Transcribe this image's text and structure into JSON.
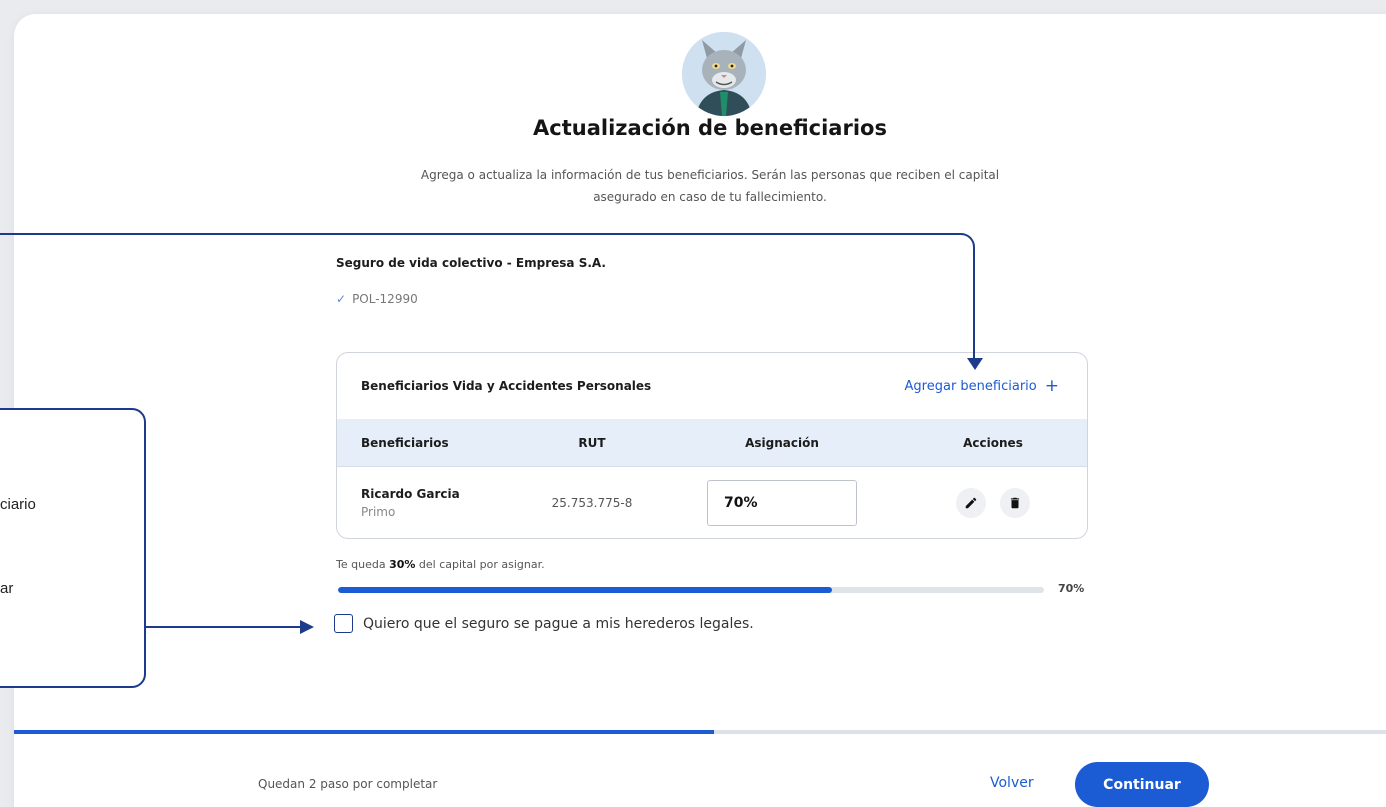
{
  "header": {
    "title": "Actualización de beneficiarios",
    "subtitle_line1": "Agrega o actualiza la información de tus beneficiarios. Serán las personas que reciben el capital",
    "subtitle_line2": "asegurado en caso de tu fallecimiento."
  },
  "policy": {
    "name": "Seguro de vida colectivo - Empresa S.A.",
    "number": "POL-12990",
    "checkmark": "✓"
  },
  "beneficiaries": {
    "section_title": "Beneficiarios Vida y Accidentes Personales",
    "add_label": "Agregar beneficiario",
    "add_icon": "+",
    "columns": [
      "Beneficiarios",
      "RUT",
      "Asignación",
      "Acciones"
    ],
    "rows": [
      {
        "name": "Ricardo Garcia",
        "relation": "Primo",
        "rut": "25.753.775-8",
        "assignment": "70%"
      }
    ]
  },
  "allocation": {
    "remaining_prefix": "Te queda ",
    "remaining_value": "30%",
    "remaining_suffix": " del capital por asignar.",
    "progress_percent": 70,
    "progress_label": "70%"
  },
  "heirs": {
    "label": "Quiero que el seguro se pague a mis herederos legales.",
    "checked": false
  },
  "footer": {
    "steps_remaining": "Quedan 2 paso por completar",
    "step_progress_fraction": 0.51,
    "back_label": "Volver",
    "continue_label": "Continuar"
  },
  "callouts": {
    "text_1": "ciario",
    "text_2": "ar"
  },
  "colors": {
    "primary": "#1b5bd3",
    "callout": "#1e3a8a",
    "header_row": "#e6eef9"
  }
}
